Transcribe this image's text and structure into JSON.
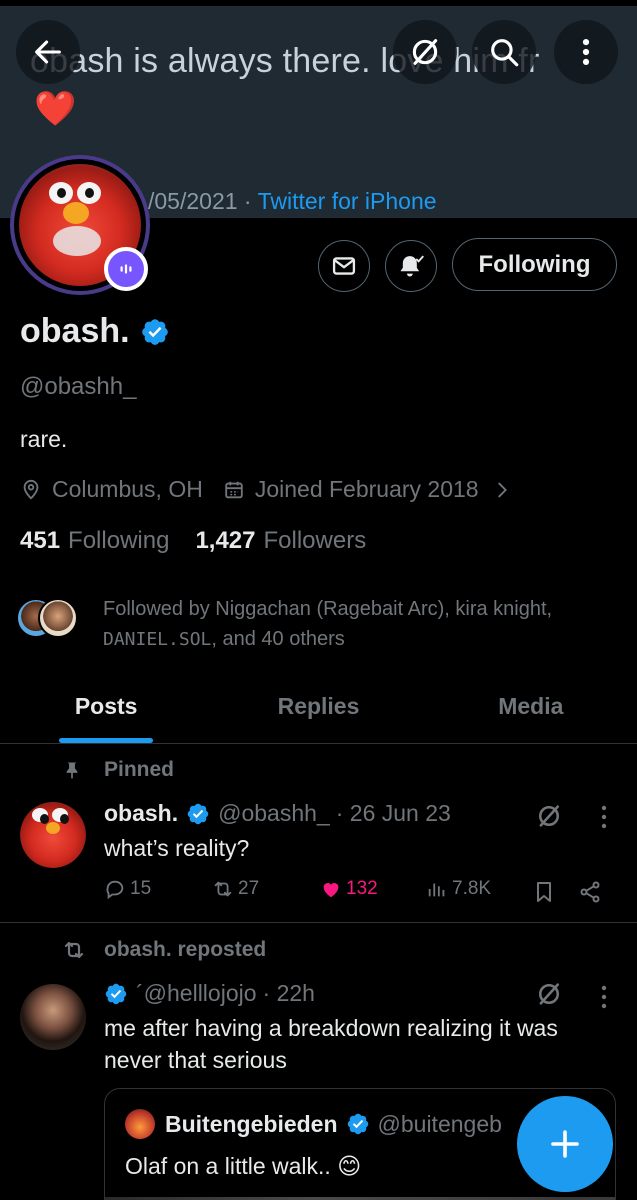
{
  "banner": {
    "tweet_text": "obash is always there. love him fr",
    "heart": "❤️",
    "date": "/05/2021",
    "separator": "·",
    "source": "Twitter for iPhone"
  },
  "header_icons": [
    "back-arrow-icon",
    "grok-icon",
    "search-icon",
    "more-vertical-icon"
  ],
  "profile": {
    "display_name": "obash.",
    "handle": "@obashh_",
    "bio": "rare.",
    "location": "Columbus, OH",
    "joined": "Joined February 2018",
    "following_count": "451",
    "following_label": "Following",
    "followers_count": "1,427",
    "followers_label": "Followers",
    "followed_by_prefix": "Followed by Niggachan (Ragebait Arc), kira knight,",
    "followed_by_mono": "DANIEL.SOL",
    "followed_by_suffix": ", and 40 others",
    "follow_button": "Following"
  },
  "tabs": [
    {
      "label": "Posts",
      "active": true
    },
    {
      "label": "Replies",
      "active": false
    },
    {
      "label": "Media",
      "active": false
    }
  ],
  "pinned_post": {
    "pinned_label": "Pinned",
    "name": "obash.",
    "handle": "@obashh_",
    "time": "· 26 Jun 23",
    "text": "what’s reality?",
    "replies": "15",
    "reposts": "27",
    "likes": "132",
    "views": "7.8K"
  },
  "repost": {
    "repost_label": "obash. reposted",
    "handle": "´@helllojojo",
    "time": "· 22h",
    "text": "me after having a breakdown realizing it was never that serious",
    "quote": {
      "name": "Buitengebieden",
      "handle": "@buitengeb",
      "text": "Olaf on a little walk.. 😊"
    }
  },
  "colors": {
    "accent": "#1d9bf0",
    "like": "#f91880",
    "background": "#000000",
    "banner": "#1f2a33",
    "muted": "#71767b"
  }
}
